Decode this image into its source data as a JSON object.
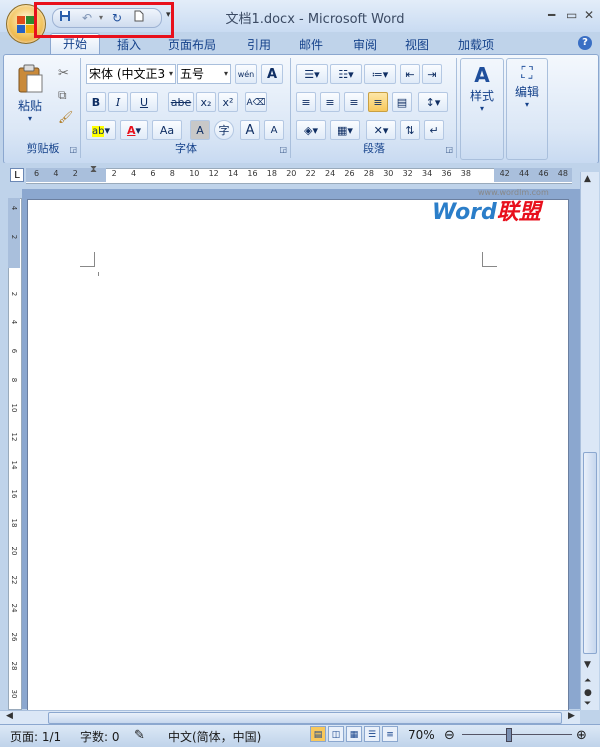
{
  "window": {
    "title": "文档1.docx - Microsoft Word"
  },
  "qat": {
    "icons": [
      "save-icon",
      "undo-icon",
      "redo-icon",
      "new-document-icon"
    ],
    "dropdown": "▾"
  },
  "tabs": [
    "开始",
    "插入",
    "页面布局",
    "引用",
    "邮件",
    "审阅",
    "视图",
    "加载项"
  ],
  "help_label": "?",
  "clipboard": {
    "paste_label": "粘贴",
    "group_label": "剪贴板"
  },
  "font": {
    "name": "宋体 (中文正3",
    "size": "五号",
    "group_label": "字体",
    "wen": "wén",
    "bold": "B",
    "italic": "I",
    "underline": "U",
    "strike": "abe",
    "sub": "x₂",
    "sup": "x²",
    "highlight": "ab",
    "color": "A",
    "case": "Aa",
    "shade": "A",
    "enclosed": "字",
    "grow": "A",
    "shrink": "A"
  },
  "paragraph": {
    "group_label": "段落"
  },
  "styles": {
    "label": "样式"
  },
  "editing": {
    "label": "编辑"
  },
  "ruler_marks": [
    "6",
    "4",
    "2",
    "",
    "2",
    "4",
    "6",
    "8",
    "10",
    "12",
    "14",
    "16",
    "18",
    "20",
    "22",
    "24",
    "26",
    "28",
    "30",
    "32",
    "34",
    "36",
    "38",
    "",
    "42",
    "44",
    "46",
    "48"
  ],
  "vruler_marks": [
    "4",
    "2",
    "",
    "2",
    "4",
    "6",
    "8",
    "10",
    "12",
    "14",
    "16",
    "18",
    "20",
    "22",
    "24",
    "26",
    "28",
    "30"
  ],
  "status": {
    "page": "页面: 1/1",
    "words": "字数: 0",
    "lang": "中文(简体，中国)",
    "zoom": "70%"
  },
  "watermark": {
    "url": "www.wordlm.com",
    "brand_a": "Word",
    "brand_b": "联盟"
  },
  "colors": {
    "accent": "#15428b",
    "highlight_box": "#e8101c",
    "font_color": "#e8101c",
    "highlight": "#ffff00"
  }
}
